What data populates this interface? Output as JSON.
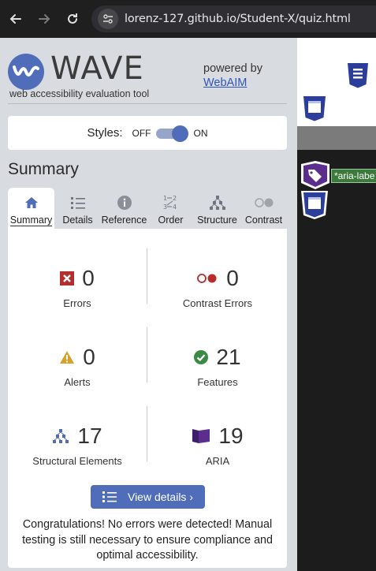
{
  "browser": {
    "url": "lorenz-127.github.io/Student-X/quiz.html"
  },
  "wave": {
    "logo_text": "WAVE",
    "tagline": "web accessibility evaluation tool",
    "powered_by": "powered by",
    "powered_link": "WebAIM"
  },
  "styles": {
    "label": "Styles:",
    "off": "OFF",
    "on": "ON",
    "state": "on"
  },
  "summary_heading": "Summary",
  "tabs": [
    {
      "label": "Summary",
      "icon": "home-icon",
      "active": true
    },
    {
      "label": "Details",
      "icon": "list-icon",
      "active": false
    },
    {
      "label": "Reference",
      "icon": "info-icon",
      "active": false
    },
    {
      "label": "Order",
      "icon": "order-icon",
      "active": false
    },
    {
      "label": "Structure",
      "icon": "structure-icon",
      "active": false
    },
    {
      "label": "Contrast",
      "icon": "contrast-icon",
      "active": false
    }
  ],
  "stats": {
    "errors": {
      "value": "0",
      "label": "Errors",
      "icon": "error-icon",
      "color": "#b52d2d"
    },
    "contrast_errors": {
      "value": "0",
      "label": "Contrast Errors",
      "icon": "contrast-error-icon",
      "color": "#b52d2d"
    },
    "alerts": {
      "value": "0",
      "label": "Alerts",
      "icon": "alert-icon",
      "color": "#d9a12a"
    },
    "features": {
      "value": "21",
      "label": "Features",
      "icon": "feature-check-icon",
      "color": "#3a8a46"
    },
    "structural": {
      "value": "17",
      "label": "Structural Elements",
      "icon": "structure-icon",
      "color": "#4f6db8"
    },
    "aria": {
      "value": "19",
      "label": "ARIA",
      "icon": "aria-icon",
      "color": "#5b2d8f"
    }
  },
  "view_details": "View details ›",
  "congrats": "Congratulations! No errors were detected! Manual testing is still necessary to ensure compliance and optimal accessibility.",
  "page_overlay": {
    "aria_label_text": "*aria-labe"
  },
  "colors": {
    "accent": "#4f6db8",
    "sidebar_bg": "#d8dbe0"
  }
}
